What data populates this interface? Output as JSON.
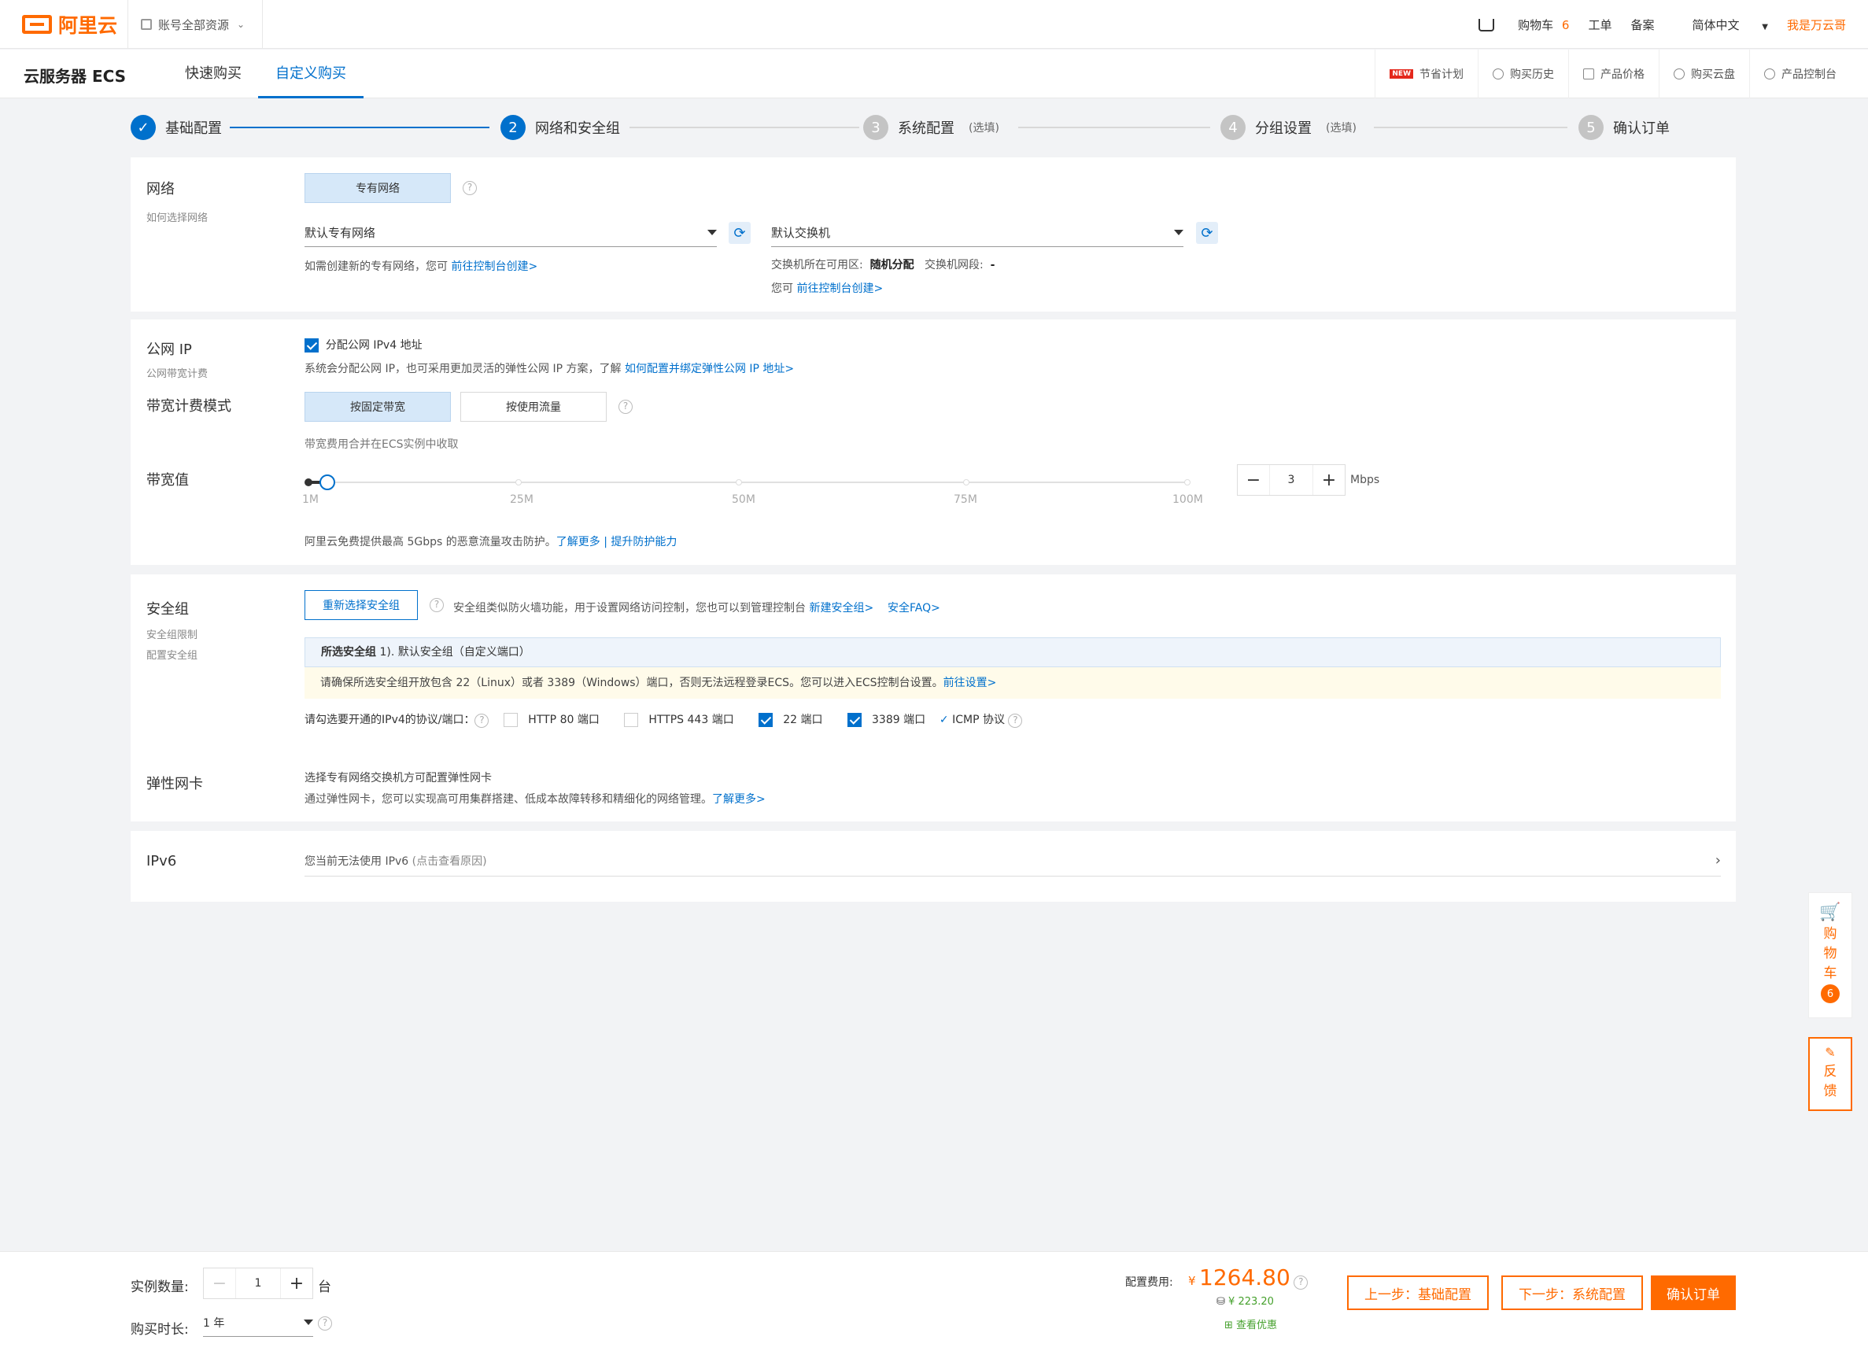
{
  "brand": {
    "name": "阿里云"
  },
  "header": {
    "account": "账号全部资源",
    "cart_label": "购物车",
    "cart_count": "6",
    "ticket": "工单",
    "filing": "备案",
    "language": "简体中文",
    "user": "我是万云哥"
  },
  "subheader": {
    "product": "云服务器 ECS",
    "tabs": [
      "快速购买",
      "自定义购买"
    ],
    "tools": [
      "节省计划",
      "购买历史",
      "产品价格",
      "购买云盘",
      "产品控制台"
    ],
    "new_badge": "NEW"
  },
  "steps": [
    {
      "num": "✓",
      "label": "基础配置",
      "opt": ""
    },
    {
      "num": "2",
      "label": "网络和安全组",
      "opt": ""
    },
    {
      "num": "3",
      "label": "系统配置",
      "opt": "(选填)"
    },
    {
      "num": "4",
      "label": "分组设置",
      "opt": "(选填)"
    },
    {
      "num": "5",
      "label": "确认订单",
      "opt": ""
    }
  ],
  "network": {
    "label": "网络",
    "sub": "如何选择网络",
    "type_btn": "专有网络",
    "vpc": "默认专有网络",
    "vpc_tip": "如需创建新的专有网络，您可",
    "vpc_link": "前往控制台创建>",
    "vswitch": "默认交换机",
    "zone_label": "交换机所在可用区:",
    "zone_value": "随机分配",
    "segment_label": "交换机网段:",
    "segment_value": "-",
    "vs_tip": "您可",
    "vs_link": "前往控制台创建>"
  },
  "public_ip": {
    "label": "公网 IP",
    "sub": "公网带宽计费",
    "assign": "分配公网 IPv4 地址",
    "tip": "系统会分配公网 IP，也可采用更加灵活的弹性公网 IP 方案，了解",
    "tip_link": "如何配置并绑定弹性公网 IP 地址>",
    "billing_label": "带宽计费模式",
    "billing_opts": [
      "按固定带宽",
      "按使用流量"
    ],
    "billing_tip": "带宽费用合并在ECS实例中收取",
    "bw_label": "带宽值",
    "bw_ticks": [
      "1M",
      "25M",
      "50M",
      "75M",
      "100M"
    ],
    "bw_value": "3",
    "bw_unit": "Mbps",
    "bw_fraction": 0.02,
    "ddos": "阿里云免费提供最高 5Gbps 的恶意流量攻击防护。",
    "ddos_more": "了解更多",
    "ddos_sep": "|",
    "ddos_up": "提升防护能力"
  },
  "security": {
    "label": "安全组",
    "sub1": "安全组限制",
    "sub2": "配置安全组",
    "reselect": "重新选择安全组",
    "tip": "安全组类似防火墙功能，用于设置网络访问控制，您也可以到管理控制台",
    "new_link": "新建安全组>",
    "faq_link": "安全FAQ>",
    "selected_label": "所选安全组",
    "selected_value": "1). 默认安全组（自定义端口）",
    "warn": "请确保所选安全组开放包含 22（Linux）或者 3389（Windows）端口，否则无法远程登录ECS。您可以进入ECS控制台设置。",
    "warn_link": "前往设置>",
    "ports_label": "请勾选要开通的IPv4的协议/端口：",
    "ports": [
      {
        "label": "HTTP 80 端口",
        "on": false
      },
      {
        "label": "HTTPS 443 端口",
        "on": false
      },
      {
        "label": "22 端口",
        "on": true
      },
      {
        "label": "3389 端口",
        "on": true
      }
    ],
    "icmp": "ICMP 协议"
  },
  "eni": {
    "label": "弹性网卡",
    "line1": "选择专有网络交换机方可配置弹性网卡",
    "line2": "通过弹性网卡，您可以实现高可用集群搭建、低成本故障转移和精细化的网络管理。",
    "more": "了解更多>"
  },
  "ipv6": {
    "label": "IPv6",
    "text": "您当前无法使用 IPv6",
    "reason": "(点击查看原因)"
  },
  "footer": {
    "qty_label": "实例数量:",
    "qty": "1",
    "qty_unit": "台",
    "dur_label": "购买时长:",
    "duration": "1 年",
    "price_label": "配置费用:",
    "currency": "¥",
    "price": "1264.80",
    "save_currency": "¥",
    "save": "223.20",
    "discount": "查看优惠",
    "prev": "上一步：基础配置",
    "next": "下一步：系统配置",
    "confirm": "确认订单"
  },
  "float": {
    "cart": [
      "购",
      "物",
      "车"
    ],
    "cart_count": "6",
    "feedback": [
      "反",
      "馈"
    ]
  }
}
